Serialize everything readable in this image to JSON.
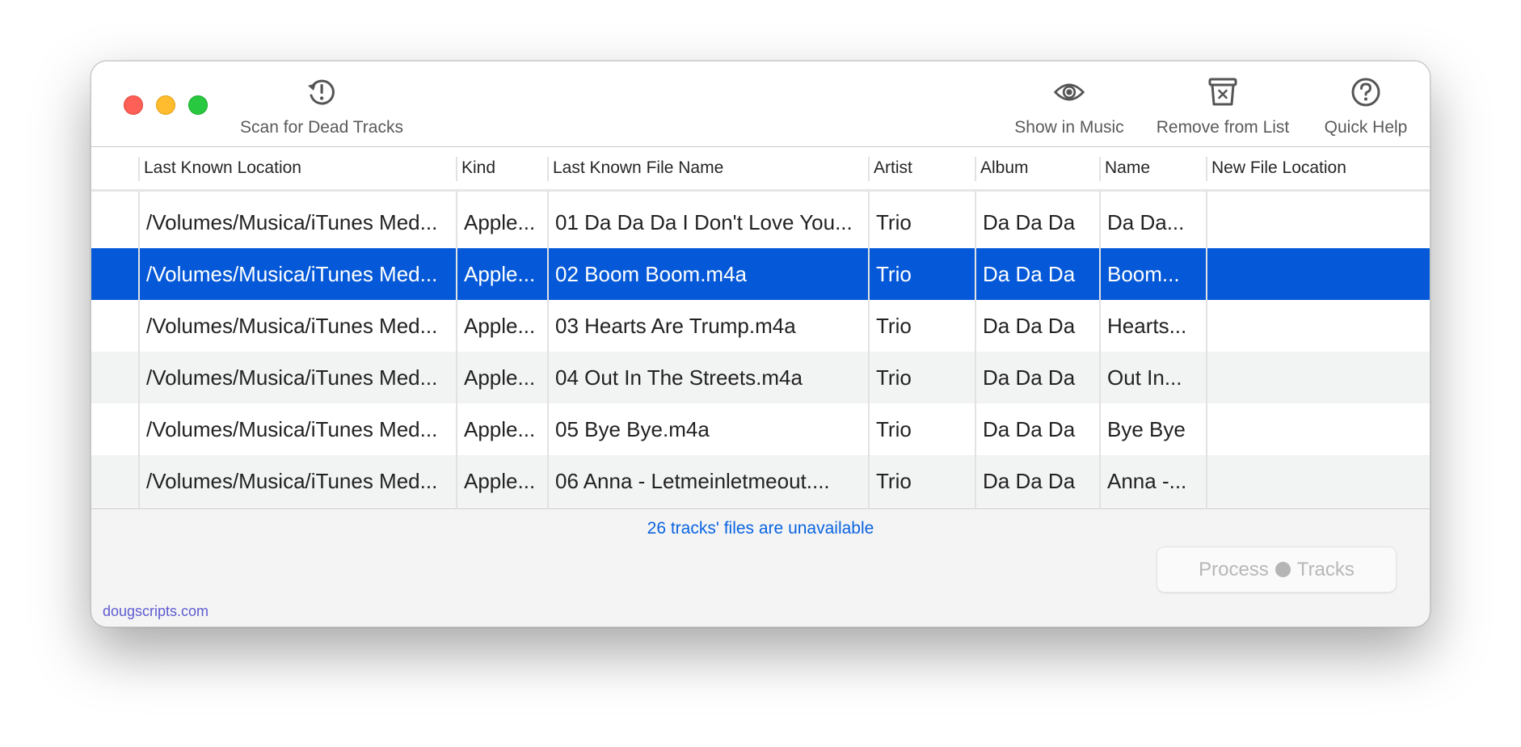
{
  "window": {
    "traffic_lights": [
      "close",
      "minimize",
      "zoom"
    ],
    "colors": {
      "close": "#fe5f57",
      "minimize": "#febc2e",
      "zoom": "#28c840",
      "selection": "#0559d8",
      "status_text": "#0a64e0",
      "link": "#5e5bd0"
    }
  },
  "toolbar": {
    "scan": {
      "label": "Scan for Dead Tracks",
      "icon": "clock-exclamation-icon"
    },
    "show_in_music": {
      "label": "Show in Music",
      "icon": "eye-icon"
    },
    "remove_from_list": {
      "label": "Remove from List",
      "icon": "trash-x-icon"
    },
    "quick_help": {
      "label": "Quick Help",
      "icon": "question-circle-icon"
    }
  },
  "table": {
    "columns": [
      "",
      "Last Known Location",
      "Kind",
      "Last Known File Name",
      "Artist",
      "Album",
      "Name",
      "New File Location"
    ],
    "selected_row": 1,
    "rows": [
      {
        "location": "/Volumes/Musica/iTunes Med...",
        "kind": "Apple...",
        "file_name": "01 Da Da Da I Don't Love You...",
        "artist": "Trio",
        "album": "Da Da Da",
        "name": "Da Da...",
        "new_location": ""
      },
      {
        "location": "/Volumes/Musica/iTunes Med...",
        "kind": "Apple...",
        "file_name": "02 Boom Boom.m4a",
        "artist": "Trio",
        "album": "Da Da Da",
        "name": "Boom...",
        "new_location": ""
      },
      {
        "location": "/Volumes/Musica/iTunes Med...",
        "kind": "Apple...",
        "file_name": "03 Hearts Are Trump.m4a",
        "artist": "Trio",
        "album": "Da Da Da",
        "name": "Hearts...",
        "new_location": ""
      },
      {
        "location": "/Volumes/Musica/iTunes Med...",
        "kind": "Apple...",
        "file_name": "04 Out In The Streets.m4a",
        "artist": "Trio",
        "album": "Da Da Da",
        "name": "Out In...",
        "new_location": ""
      },
      {
        "location": "/Volumes/Musica/iTunes Med...",
        "kind": "Apple...",
        "file_name": "05 Bye Bye.m4a",
        "artist": "Trio",
        "album": "Da Da Da",
        "name": "Bye Bye",
        "new_location": ""
      },
      {
        "location": "/Volumes/Musica/iTunes Med...",
        "kind": "Apple...",
        "file_name": "06 Anna - Letmeinletmeout....",
        "artist": "Trio",
        "album": "Da Da Da",
        "name": "Anna -...",
        "new_location": ""
      }
    ]
  },
  "footer": {
    "status": "26 tracks' files are unavailable",
    "process_button": {
      "label_left": "Process",
      "label_right": "Tracks",
      "enabled": false
    },
    "link": "dougscripts.com"
  }
}
